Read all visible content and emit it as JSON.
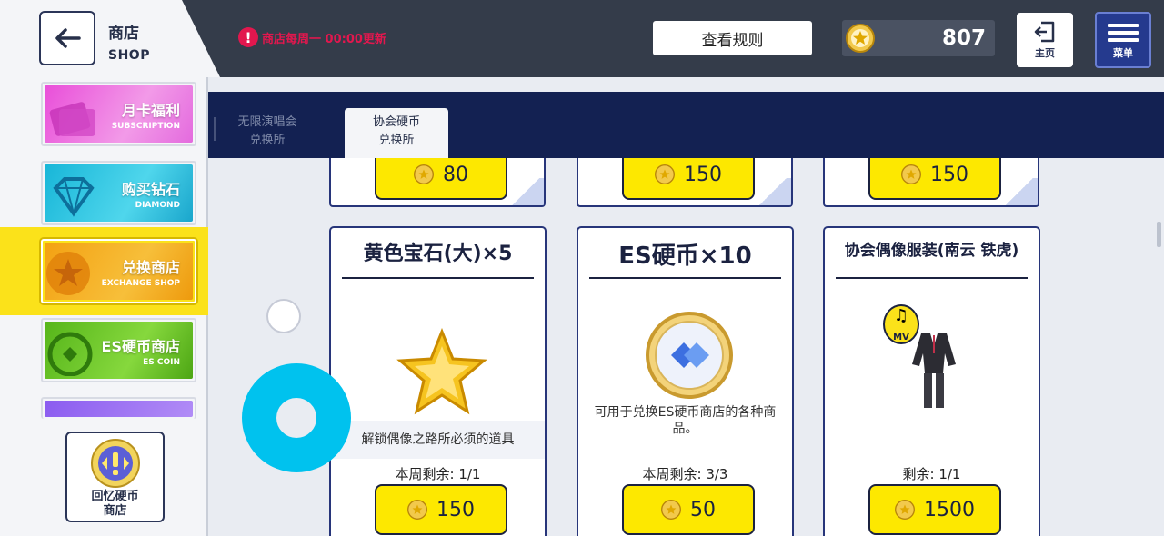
{
  "header": {
    "shop_cn": "商店",
    "shop_en": "SHOP",
    "notice": "商店每周一 00:00更新",
    "rules_label": "查看规则",
    "coins": "807",
    "home_label": "主页",
    "menu_label": "菜单"
  },
  "sidebar": {
    "items": [
      {
        "cn": "月卡福利",
        "en": "SUBSCRIPTION"
      },
      {
        "cn": "购买钻石",
        "en": "DIAMOND"
      },
      {
        "cn": "兑换商店",
        "en": "EXCHANGE SHOP"
      },
      {
        "cn": "ES硬币商店",
        "en": "ES COIN"
      }
    ],
    "recall_line1": "回忆硬币",
    "recall_line2": "商店"
  },
  "tabs": [
    {
      "line1": "无限演唱会",
      "line2": "兑换所"
    },
    {
      "line1": "协会硬币",
      "line2": "兑换所"
    }
  ],
  "top_row_prices": [
    "80",
    "150",
    "150"
  ],
  "cards": [
    {
      "title": "黄色宝石(大)×5",
      "desc": "解锁偶像之路所必须的道具",
      "remain": "本周剩余: 1/1",
      "price": "150"
    },
    {
      "title": "ES硬币×10",
      "desc": "可用于兑换ES硬币商店的各种商品。",
      "remain": "本周剩余: 3/3",
      "price": "50"
    },
    {
      "title": "协会偶像服装(南云 铁虎)",
      "desc": "",
      "remain": "剩余: 1/1",
      "price": "1500"
    }
  ],
  "mv_badge": "MV"
}
